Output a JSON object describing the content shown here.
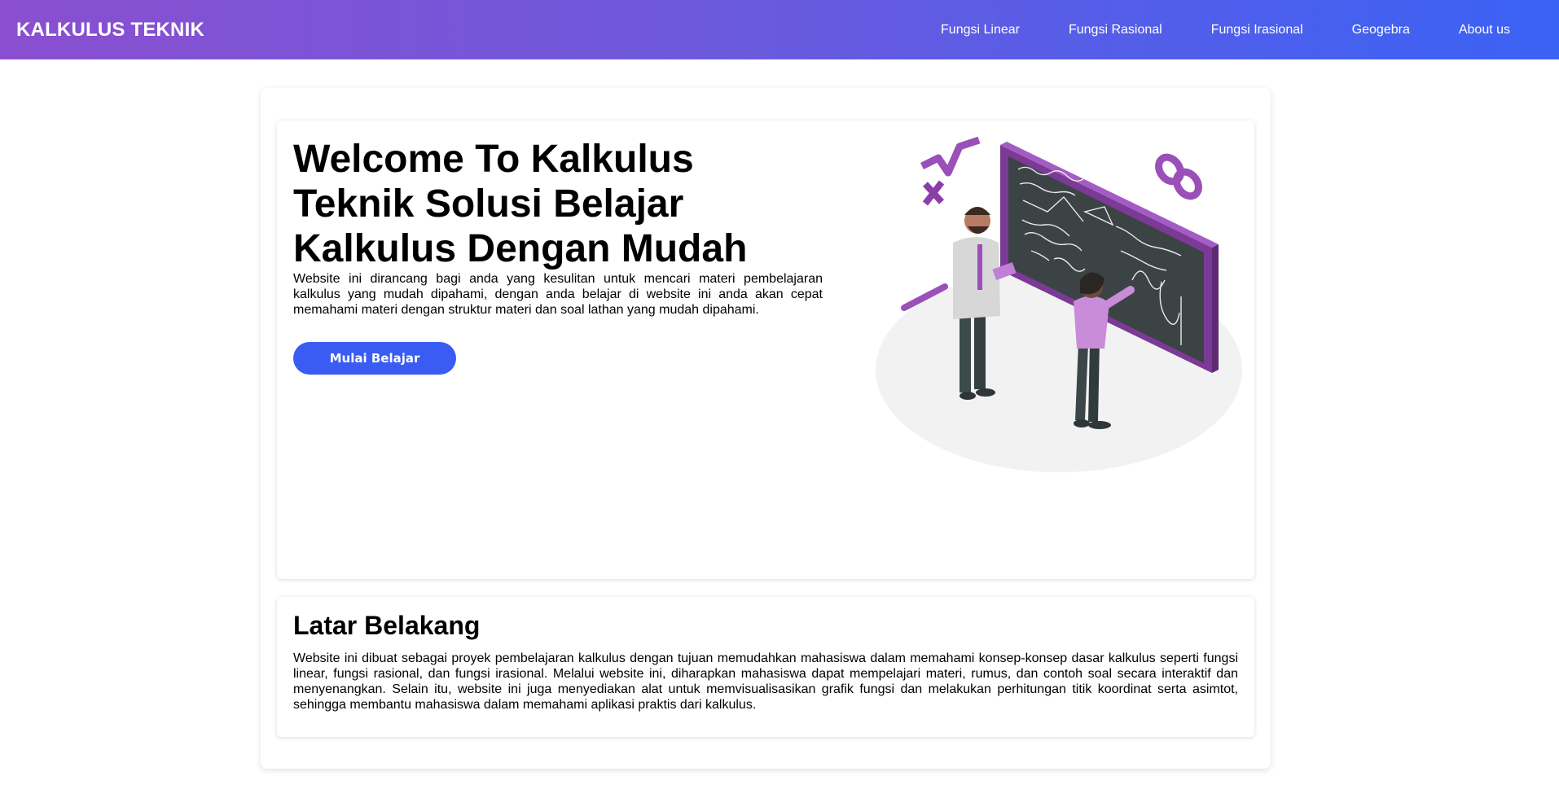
{
  "navbar": {
    "brand": "KALKULUS TEKNIK",
    "links": [
      "Fungsi Linear",
      "Fungsi Rasional",
      "Fungsi Irasional",
      "Geogebra",
      "About us"
    ]
  },
  "hero": {
    "title": "Welcome To Kalkulus Teknik Solusi Belajar Kalkulus Dengan Mudah",
    "description": "Website ini dirancang bagi anda yang kesulitan untuk mencari materi pembelajaran kalkulus yang mudah dipahami, dengan anda belajar di website ini anda akan cepat memahami materi dengan struktur materi dan soal lathan yang mudah dipahami.",
    "cta_label": "Mulai Belajar"
  },
  "about": {
    "title": "Latar Belakang",
    "text": "Website ini dibuat sebagai proyek pembelajaran kalkulus dengan tujuan memudahkan mahasiswa dalam memahami konsep-konsep dasar kalkulus seperti fungsi linear, fungsi rasional, dan fungsi irasional. Melalui website ini, diharapkan mahasiswa dapat mempelajari materi, rumus, dan contoh soal secara interaktif dan menyenangkan. Selain itu, website ini juga menyediakan alat untuk memvisualisasikan grafik fungsi dan melakukan perhitungan titik koordinat serta asimtot, sehingga membantu mahasiswa dalam memahami aplikasi praktis dari kalkulus."
  },
  "colors": {
    "nav_gradient_start": "#8a4fd0",
    "nav_gradient_end": "#3a62f5",
    "cta": "#3a5cf3",
    "accent_purple": "#9b4fb8"
  },
  "icons": [
    "math-symbols-icon",
    "infinity-icon",
    "chalkboard-illustration"
  ]
}
